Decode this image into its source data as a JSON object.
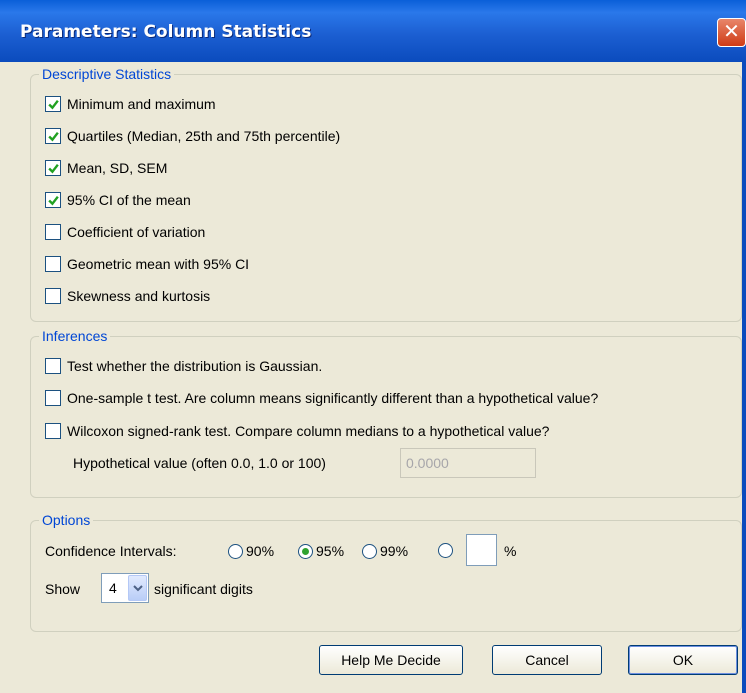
{
  "window": {
    "title": "Parameters: Column Statistics"
  },
  "descriptive": {
    "legend": "Descriptive Statistics",
    "items": [
      {
        "label": "Minimum and maximum",
        "checked": true
      },
      {
        "label": "Quartiles (Median, 25th and 75th percentile)",
        "checked": true
      },
      {
        "label": "Mean, SD, SEM",
        "checked": true
      },
      {
        "label": "95% CI of the mean",
        "checked": true
      },
      {
        "label": "Coefficient of variation",
        "checked": false
      },
      {
        "label": "Geometric mean with 95% CI",
        "checked": false
      },
      {
        "label": "Skewness and kurtosis",
        "checked": false
      }
    ]
  },
  "inferences": {
    "legend": "Inferences",
    "items": [
      {
        "label": "Test whether the distribution is Gaussian.",
        "checked": false
      },
      {
        "label": "One-sample t test. Are column means significantly different than a hypothetical value?",
        "checked": false
      },
      {
        "label": "Wilcoxon signed-rank test. Compare column medians to a hypothetical value?",
        "checked": false
      }
    ],
    "hypothetical_label": "Hypothetical value (often 0.0, 1.0 or 100)",
    "hypothetical_value": "0.0000"
  },
  "options": {
    "legend": "Options",
    "ci_label": "Confidence Intervals:",
    "ci_options": [
      {
        "label": "90%",
        "selected": false
      },
      {
        "label": "95%",
        "selected": true
      },
      {
        "label": "99%",
        "selected": false
      }
    ],
    "ci_custom_unit": "%",
    "ci_custom_value": "",
    "show_label": "Show",
    "digits_value": "4",
    "digits_suffix": "significant digits"
  },
  "buttons": {
    "help": "Help Me Decide",
    "cancel": "Cancel",
    "ok": "OK"
  },
  "colors": {
    "title_bar": "#0b4bbd",
    "group_legend": "#0046d5",
    "checkmark": "#21a121"
  }
}
